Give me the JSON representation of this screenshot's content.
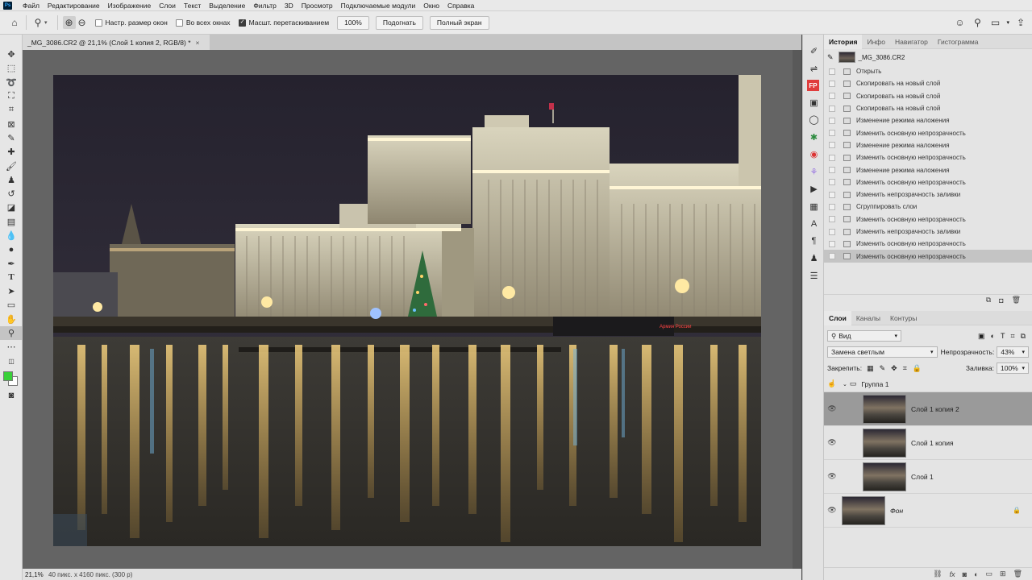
{
  "menubar": {
    "items": [
      "Файл",
      "Редактирование",
      "Изображение",
      "Слои",
      "Текст",
      "Выделение",
      "Фильтр",
      "3D",
      "Просмотр",
      "Подключаемые модули",
      "Окно",
      "Справка"
    ]
  },
  "options": {
    "resize_windows": "Настр. размер окон",
    "all_windows": "Во всех окнах",
    "scrubby_zoom": "Масшт. перетаскиванием",
    "zoom_value": "100%",
    "fit_label": "Подогнать",
    "fullscreen_label": "Полный экран"
  },
  "document": {
    "tab_title": "_MG_3086.CR2 @ 21,1% (Слой 1 копия 2, RGB/8) *",
    "close": "×",
    "zoom": "21,1%",
    "info": "40 пикс. x 4160 пикс. (300 p)",
    "sign_text": "Армия России"
  },
  "history": {
    "tabs": [
      "История",
      "Инфо",
      "Навигатор",
      "Гистограмма"
    ],
    "snapshot": "_MG_3086.CR2",
    "items": [
      "Открыть",
      "Скопировать на новый слой",
      "Скопировать на новый слой",
      "Скопировать на новый слой",
      "Изменение режима наложения",
      "Изменить основную непрозрачность",
      "Изменение режима наложения",
      "Изменить основную непрозрачность",
      "Изменение режима наложения",
      "Изменить основную непрозрачность",
      "Изменить непрозрачность заливки",
      "Сгруппировать слои",
      "Изменить основную непрозрачность",
      "Изменить непрозрачность заливки",
      "Изменить основную непрозрачность",
      "Изменить основную непрозрачность"
    ],
    "selected_index": 15
  },
  "layers": {
    "tabs": [
      "Слои",
      "Каналы",
      "Контуры"
    ],
    "filter": "Вид",
    "blend_mode": "Замена светлым",
    "opacity_label": "Непрозрачность:",
    "opacity": "43%",
    "lock_label": "Закрепить:",
    "fill_label": "Заливка:",
    "fill": "100%",
    "group_name": "Группа 1",
    "items": [
      "Слой 1 копия 2",
      "Слой 1 копия",
      "Слой 1"
    ],
    "background_name": "Фон"
  },
  "colors": {
    "foreground": "#39d039",
    "background": "#ffffff"
  }
}
